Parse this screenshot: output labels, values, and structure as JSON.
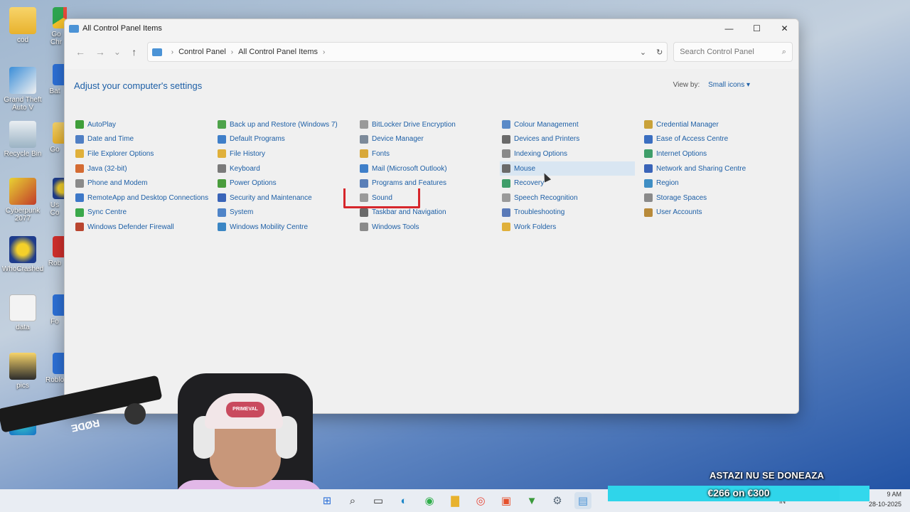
{
  "desktop": {
    "icons": [
      {
        "label": "cod",
        "glyph": "folder-icon"
      },
      {
        "label": "Grand Theft Auto V",
        "glyph": "gta-icon"
      },
      {
        "label": "Recycle Bin",
        "glyph": "recycle-bin-icon"
      },
      {
        "label": "Cyberpunk 2077",
        "glyph": "cyberpunk-icon"
      },
      {
        "label": "WhoCrashed",
        "glyph": "whocrashed-icon"
      },
      {
        "label": "data",
        "glyph": "document-icon"
      },
      {
        "label": "pics",
        "glyph": "folder-icon"
      }
    ],
    "partial_labels": [
      "Go Chr",
      "Bat",
      "Go",
      "Us Co",
      "Rob",
      "Fo",
      "Roblo"
    ]
  },
  "window": {
    "title": "All Control Panel Items",
    "controls": {
      "minimize": "—",
      "maximize": "☐",
      "close": "✕"
    },
    "nav": {
      "back": "←",
      "forward": "→",
      "recent": "⌄",
      "up": "↑"
    },
    "breadcrumb": [
      "Control Panel",
      "All Control Panel Items"
    ],
    "search_placeholder": "Search Control Panel",
    "heading": "Adjust your computer's settings",
    "view_by_label": "View by:",
    "view_by_value": "Small icons ▾",
    "hovered_item": "Mouse",
    "highlighted_item": "Sound",
    "columns": [
      [
        {
          "label": "AutoPlay",
          "color": "#3f9e3a"
        },
        {
          "label": "Date and Time",
          "color": "#4f7fc4"
        },
        {
          "label": "File Explorer Options",
          "color": "#e0b03a"
        },
        {
          "label": "Java (32-bit)",
          "color": "#d46b32"
        },
        {
          "label": "Phone and Modem",
          "color": "#8a8a8a"
        },
        {
          "label": "RemoteApp and Desktop Connections",
          "color": "#3d78c8"
        },
        {
          "label": "Sync Centre",
          "color": "#3aa84a"
        },
        {
          "label": "Windows Defender Firewall",
          "color": "#b9452f"
        }
      ],
      [
        {
          "label": "Back up and Restore (Windows 7)",
          "color": "#4ea34a"
        },
        {
          "label": "Default Programs",
          "color": "#3f7fc9"
        },
        {
          "label": "File History",
          "color": "#e0b03a"
        },
        {
          "label": "Keyboard",
          "color": "#7a7a7a"
        },
        {
          "label": "Power Options",
          "color": "#4a9c3c"
        },
        {
          "label": "Security and Maintenance",
          "color": "#3a64b8"
        },
        {
          "label": "System",
          "color": "#4f84c8"
        },
        {
          "label": "Windows Mobility Centre",
          "color": "#3b86c4"
        }
      ],
      [
        {
          "label": "BitLocker Drive Encryption",
          "color": "#9a9a9a"
        },
        {
          "label": "Device Manager",
          "color": "#7c8a9a"
        },
        {
          "label": "Fonts",
          "color": "#d8a83a"
        },
        {
          "label": "Mail (Microsoft Outlook)",
          "color": "#3f7fc9"
        },
        {
          "label": "Programs and Features",
          "color": "#5a7fb8"
        },
        {
          "label": "Sound",
          "color": "#9a9a9a"
        },
        {
          "label": "Taskbar and Navigation",
          "color": "#6a6a6a"
        },
        {
          "label": "Windows Tools",
          "color": "#8a8a8a"
        }
      ],
      [
        {
          "label": "Colour Management",
          "color": "#5a8ac8"
        },
        {
          "label": "Devices and Printers",
          "color": "#6a6a6a"
        },
        {
          "label": "Indexing Options",
          "color": "#8a8a8a"
        },
        {
          "label": "Mouse",
          "color": "#6a6a6a"
        },
        {
          "label": "Recovery",
          "color": "#3f9e6a"
        },
        {
          "label": "Speech Recognition",
          "color": "#9a9a9a"
        },
        {
          "label": "Troubleshooting",
          "color": "#5a7ab8"
        },
        {
          "label": "Work Folders",
          "color": "#e0b03a"
        }
      ],
      [
        {
          "label": "Credential Manager",
          "color": "#c9a23a"
        },
        {
          "label": "Ease of Access Centre",
          "color": "#3a6ec0"
        },
        {
          "label": "Internet Options",
          "color": "#3f9e6a"
        },
        {
          "label": "Network and Sharing Centre",
          "color": "#3a64b8"
        },
        {
          "label": "Region",
          "color": "#3f8ec4"
        },
        {
          "label": "Storage Spaces",
          "color": "#8a8a8a"
        },
        {
          "label": "User Accounts",
          "color": "#b88a3a"
        }
      ]
    ]
  },
  "overlay": {
    "donate_title": "ASTAZI NU SE DONEAZA",
    "donate_progress": "€266 on €300",
    "donate_fraction": 0.887
  },
  "webcam": {
    "mic_brand": "RØDE",
    "cap_text": "PRIMEVAL"
  },
  "taskbar": {
    "time": "9 AM",
    "date": "28-10-2025",
    "language": "IN"
  }
}
